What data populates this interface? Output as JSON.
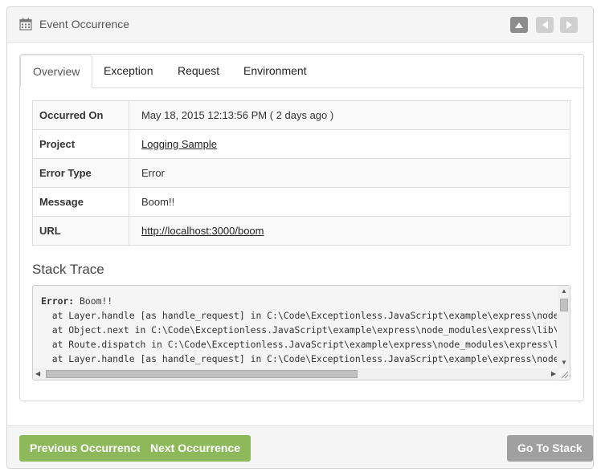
{
  "header": {
    "title": "Event Occurrence",
    "icon": "calendar-icon"
  },
  "tabs": [
    {
      "label": "Overview",
      "active": true
    },
    {
      "label": "Exception"
    },
    {
      "label": "Request"
    },
    {
      "label": "Environment"
    }
  ],
  "details": [
    {
      "key": "Occurred On",
      "value": "May 18, 2015 12:13:56 PM ( 2 days ago )"
    },
    {
      "key": "Project",
      "value": "Logging Sample"
    },
    {
      "key": "Error Type",
      "value": "Error"
    },
    {
      "key": "Message",
      "value": "Boom!!"
    },
    {
      "key": "URL",
      "value": "http://localhost:3000/boom"
    }
  ],
  "stack": {
    "title": "Stack Trace",
    "error_label": "Error:",
    "error_message": " Boom!!",
    "lines": [
      "  at Layer.handle [as handle_request] in C:\\Code\\Exceptionless.JavaScript\\example\\express\\node_modules\\express\\lib\\router\\layer.js",
      "  at Object.next in C:\\Code\\Exceptionless.JavaScript\\example\\express\\node_modules\\express\\lib\\router\\route.js",
      "  at Route.dispatch in C:\\Code\\Exceptionless.JavaScript\\example\\express\\node_modules\\express\\lib\\router\\route.js",
      "  at Layer.handle [as handle_request] in C:\\Code\\Exceptionless.JavaScript\\example\\express\\node_modules\\express\\lib\\router\\layer.js"
    ]
  },
  "footer": {
    "previous_label": "Previous Occurrence",
    "next_label": "Next Occurrence",
    "stack_label": "Go To Stack"
  },
  "colors": {
    "accent_green": "#8db95b",
    "button_gray": "#a0a0a0"
  }
}
